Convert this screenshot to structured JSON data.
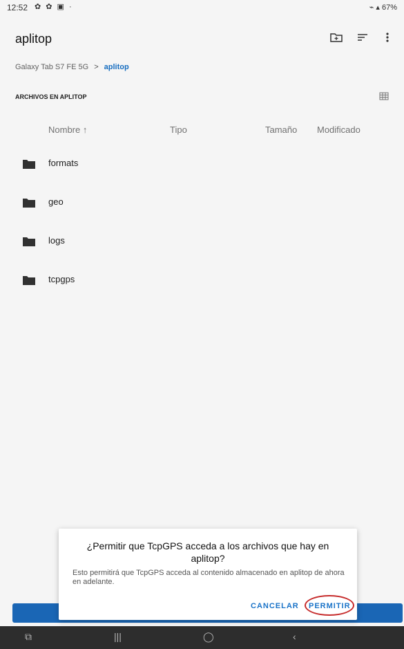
{
  "status": {
    "time": "12:52",
    "battery": "67%"
  },
  "appbar": {
    "title": "aplitop"
  },
  "breadcrumb": {
    "root": "Galaxy Tab S7 FE 5G",
    "separator": ">",
    "current": "aplitop"
  },
  "section": {
    "label": "ARCHIVOS EN APLITOP"
  },
  "columns": {
    "name": "Nombre ↑",
    "type": "Tipo",
    "size": "Tamaño",
    "modified": "Modificado"
  },
  "files": [
    {
      "name": "formats"
    },
    {
      "name": "geo"
    },
    {
      "name": "logs"
    },
    {
      "name": "tcpgps"
    }
  ],
  "dialog": {
    "title": "¿Permitir que TcpGPS acceda a los archivos que hay en aplitop?",
    "body": "Esto permitirá que TcpGPS acceda al contenido almacenado en aplitop de ahora en adelante.",
    "cancel": "CANCELAR",
    "allow": "PERMITIR"
  },
  "colors": {
    "accent": "#1a73c8",
    "highlight_ring": "#c62b2b",
    "primary_bar": "#1c6bbd"
  },
  "icons": {
    "new_folder": "new-folder-icon",
    "sort": "sort-icon",
    "more": "more-vert-icon",
    "grid": "grid-view-icon",
    "folder": "folder-icon"
  }
}
